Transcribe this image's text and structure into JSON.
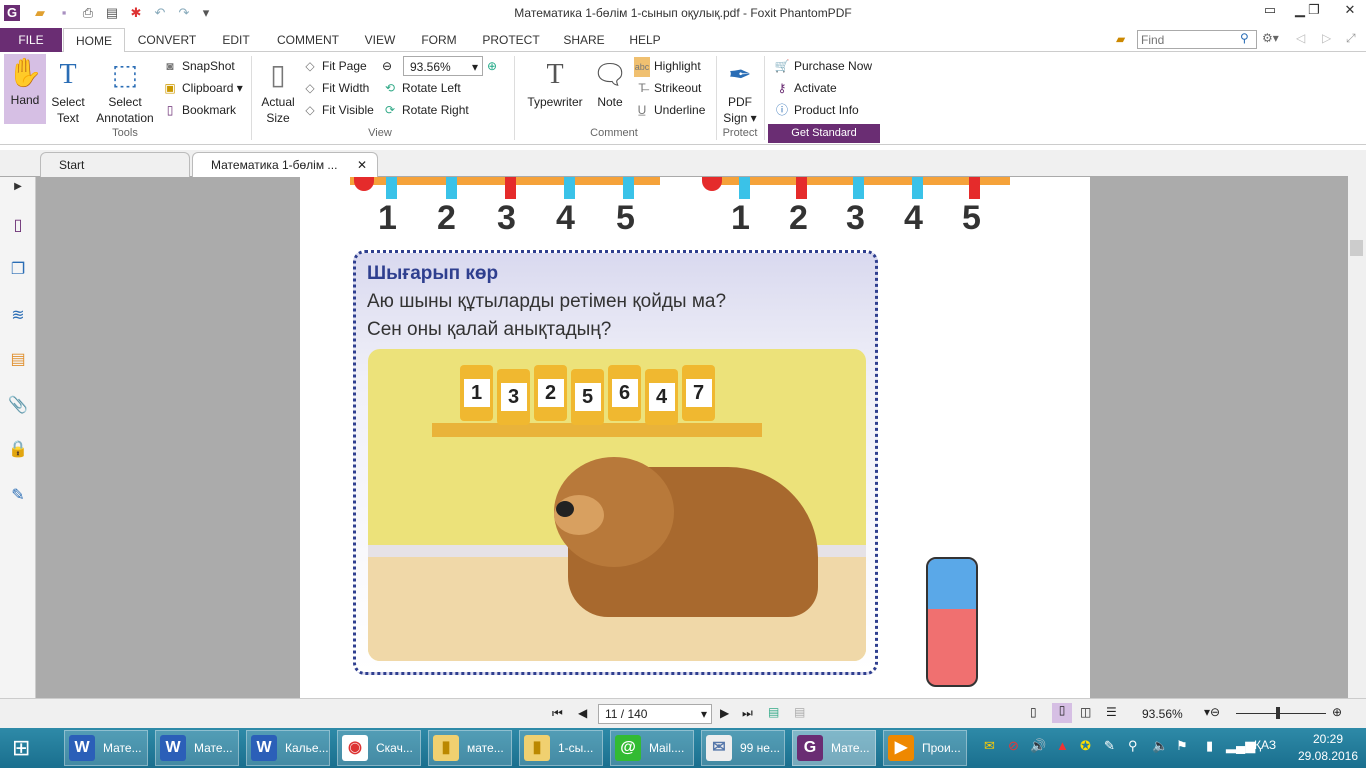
{
  "window": {
    "title": "Математика 1-бөлім 1-сынып оқулық.pdf - Foxit PhantomPDF"
  },
  "ribbon_tabs": [
    "FILE",
    "HOME",
    "CONVERT",
    "EDIT",
    "COMMENT",
    "VIEW",
    "FORM",
    "PROTECT",
    "SHARE",
    "HELP"
  ],
  "search": {
    "placeholder": "Find"
  },
  "tools": {
    "hand": "Hand",
    "select_text": "Select Text",
    "select_annotation": "Select Annotation",
    "snapshot": "SnapShot",
    "clipboard": "Clipboard",
    "bookmark": "Bookmark",
    "group": "Tools"
  },
  "view": {
    "actual_size": "Actual Size",
    "fit_page": "Fit Page",
    "fit_width": "Fit Width",
    "fit_visible": "Fit Visible",
    "zoom": "93.56%",
    "rotate_left": "Rotate Left",
    "rotate_right": "Rotate Right",
    "group": "View"
  },
  "comment": {
    "typewriter": "Typewriter",
    "note": "Note",
    "highlight": "Highlight",
    "strikeout": "Strikeout",
    "underline": "Underline",
    "group": "Comment"
  },
  "protect": {
    "pdf_sign": "PDF Sign",
    "group": "Protect"
  },
  "standard": {
    "purchase": "Purchase Now",
    "activate": "Activate",
    "product_info": "Product Info",
    "group": "Get Standard"
  },
  "doc_tabs": [
    "Start",
    "Математика 1-бөлім ..."
  ],
  "page": {
    "numbers_left": [
      "1",
      "2",
      "3",
      "4",
      "5"
    ],
    "numbers_right": [
      "1",
      "2",
      "3",
      "4",
      "5"
    ],
    "box_title": "Шығарып көр",
    "line1": "Аю шыны құтыларды ретімен қойды ма?",
    "line2": "Сен оны қалай анықтадың?",
    "jars": [
      "1",
      "3",
      "2",
      "5",
      "6",
      "4",
      "7"
    ]
  },
  "status": {
    "page": "11 / 140",
    "zoom": "93.56%",
    "zoom_level": 0.47
  },
  "taskbar": {
    "items": [
      {
        "label": "Мате...",
        "icon": "word"
      },
      {
        "label": "Мате...",
        "icon": "word"
      },
      {
        "label": "Кальe...",
        "icon": "word"
      },
      {
        "label": "Скач...",
        "icon": "chrome"
      },
      {
        "label": "мате...",
        "icon": "folder"
      },
      {
        "label": "1-сы...",
        "icon": "folder"
      },
      {
        "label": "Mail....",
        "icon": "mail-agent"
      },
      {
        "label": "99 не...",
        "icon": "mail"
      },
      {
        "label": "Мате...",
        "icon": "foxit"
      },
      {
        "label": "Прои...",
        "icon": "player"
      }
    ],
    "lang": "ҚАЗ",
    "time": "20:29",
    "date": "29.08.2016"
  }
}
